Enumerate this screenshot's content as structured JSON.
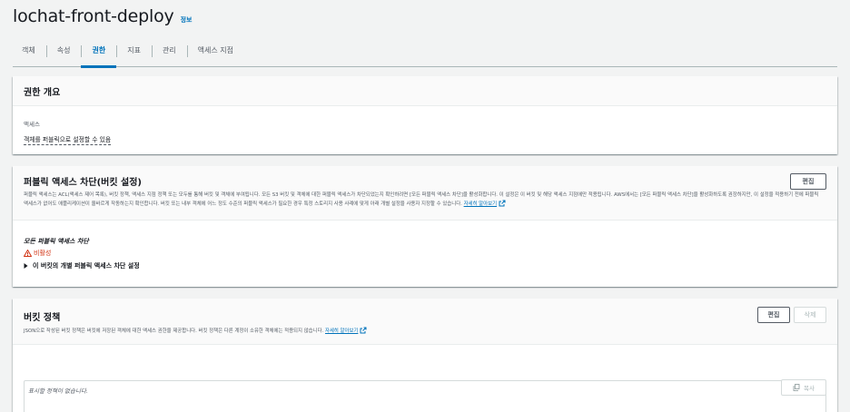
{
  "header": {
    "bucket_name": "lochat-front-deploy",
    "info_label": "정보"
  },
  "tabs": [
    {
      "label": "객체",
      "active": false
    },
    {
      "label": "속성",
      "active": false
    },
    {
      "label": "권한",
      "active": true
    },
    {
      "label": "지표",
      "active": false
    },
    {
      "label": "관리",
      "active": false
    },
    {
      "label": "액세스 지점",
      "active": false
    }
  ],
  "overview": {
    "title": "권한 개요",
    "access_label": "액세스",
    "access_value": "객체를 퍼블릭으로 설정할 수 있음"
  },
  "block_public": {
    "title": "퍼블릭 액세스 차단(버킷 설정)",
    "edit_label": "편집",
    "description": "퍼블릭 액세스는 ACL(액세스 제어 목록), 버킷 정책, 액세스 지점 정책 또는 모두를 통해 버킷 및 객체에 부여됩니다. 모든 S3 버킷 및 객체에 대한 퍼블릭 액세스가 차단되었는지 확인하려면 [모든 퍼블릭 액세스 차단]을 활성화합니다. 이 설정은 이 버킷 및 해당 액세스 지점에만 적용됩니다. AWS에서는 [모든 퍼블릭 액세스 차단]을 활성화하도록 권장하지만, 이 설정을 적용하기 전에 퍼블릭 액세스가 없어도 애플리케이션이 올바르게 작동하는지 확인합니다. 버킷 또는 내부 객체에 어느 정도 수준의 퍼블릭 액세스가 필요한 경우 특정 스토리지 사용 사례에 맞게 아래 개별 설정을 사용자 지정할 수 있습니다.",
    "learn_more": "자세히 알아보기",
    "all_block_label": "모든 퍼블릭 액세스 차단",
    "status": "비활성",
    "status_color": "#d13212",
    "expand_label": "이 버킷의 개별 퍼블릭 액세스 차단 설정"
  },
  "bucket_policy": {
    "title": "버킷 정책",
    "edit_label": "편집",
    "delete_label": "삭제",
    "description": "JSON으로 작성된 버킷 정책은 버킷에 저장된 객체에 대한 액세스 권한을 제공합니다. 버킷 정책은 다른 계정이 소유한 객체에는 적용되지 않습니다.",
    "learn_more": "자세히 알아보기",
    "empty_text": "표시할 정책이 없습니다.",
    "copy_label": "복사"
  },
  "colors": {
    "accent": "#0073bb",
    "background": "#f2f3f3",
    "panel": "#ffffff",
    "danger": "#d13212"
  }
}
